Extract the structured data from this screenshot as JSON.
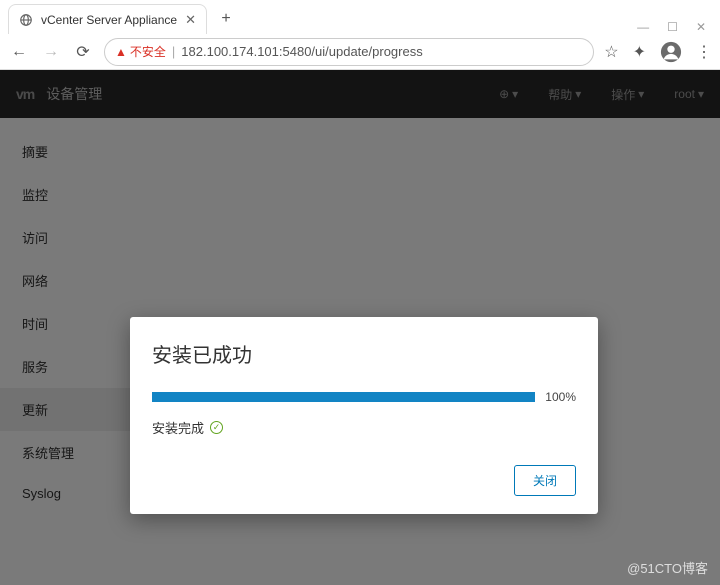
{
  "browser": {
    "tab_title": "vCenter Server Appliance",
    "insecure_label": "不安全",
    "url": "182.100.174.101:5480/ui/update/progress"
  },
  "header": {
    "logo": "vm",
    "title": "设备管理",
    "menu": {
      "lang": "⊕",
      "help": "帮助",
      "actions": "操作",
      "user": "root"
    }
  },
  "sidebar": {
    "items": [
      {
        "label": "摘要"
      },
      {
        "label": "监控"
      },
      {
        "label": "访问"
      },
      {
        "label": "网络"
      },
      {
        "label": "时间"
      },
      {
        "label": "服务"
      },
      {
        "label": "更新",
        "active": true
      },
      {
        "label": "系统管理"
      },
      {
        "label": "Syslog"
      }
    ]
  },
  "modal": {
    "title": "安装已成功",
    "percent": "100%",
    "status": "安装完成",
    "close_label": "关闭"
  },
  "watermark": "@51CTO博客"
}
